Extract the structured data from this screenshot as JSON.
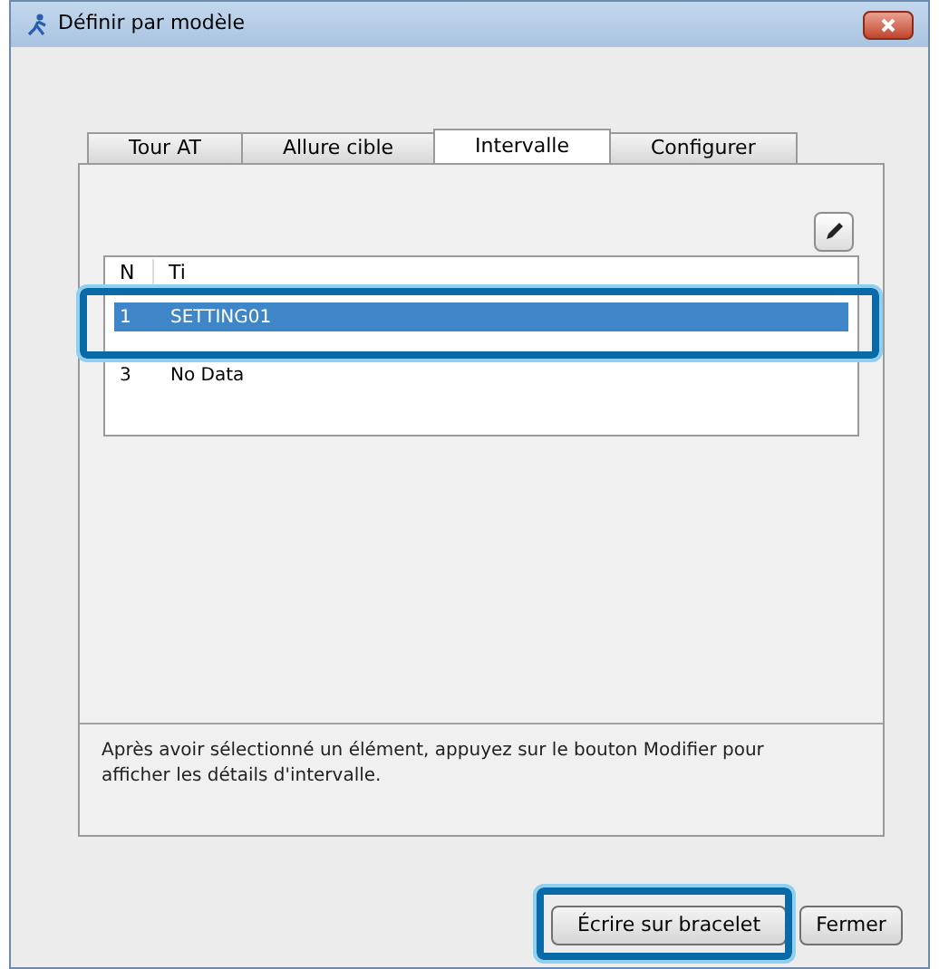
{
  "window": {
    "title": "Définir par modèle"
  },
  "tabs": [
    {
      "label": "Tour AT",
      "selected": false
    },
    {
      "label": "Allure cible",
      "selected": false
    },
    {
      "label": "Intervalle",
      "selected": true
    },
    {
      "label": "Configurer",
      "selected": false
    }
  ],
  "list": {
    "columns": [
      "N",
      "Ti"
    ],
    "rows": [
      {
        "number": "1",
        "title": "SETTING01",
        "selected": true,
        "highlighted": true
      },
      {
        "number": "3",
        "title": "No Data",
        "selected": false,
        "highlighted": false
      }
    ]
  },
  "hint": "Après avoir sélectionné un élément, appuyez sur le bouton Modifier pour afficher les détails d'intervalle.",
  "buttons": [
    {
      "label": "Écrire sur bracelet",
      "highlighted": true
    },
    {
      "label": "Fermer",
      "highlighted": false
    }
  ]
}
